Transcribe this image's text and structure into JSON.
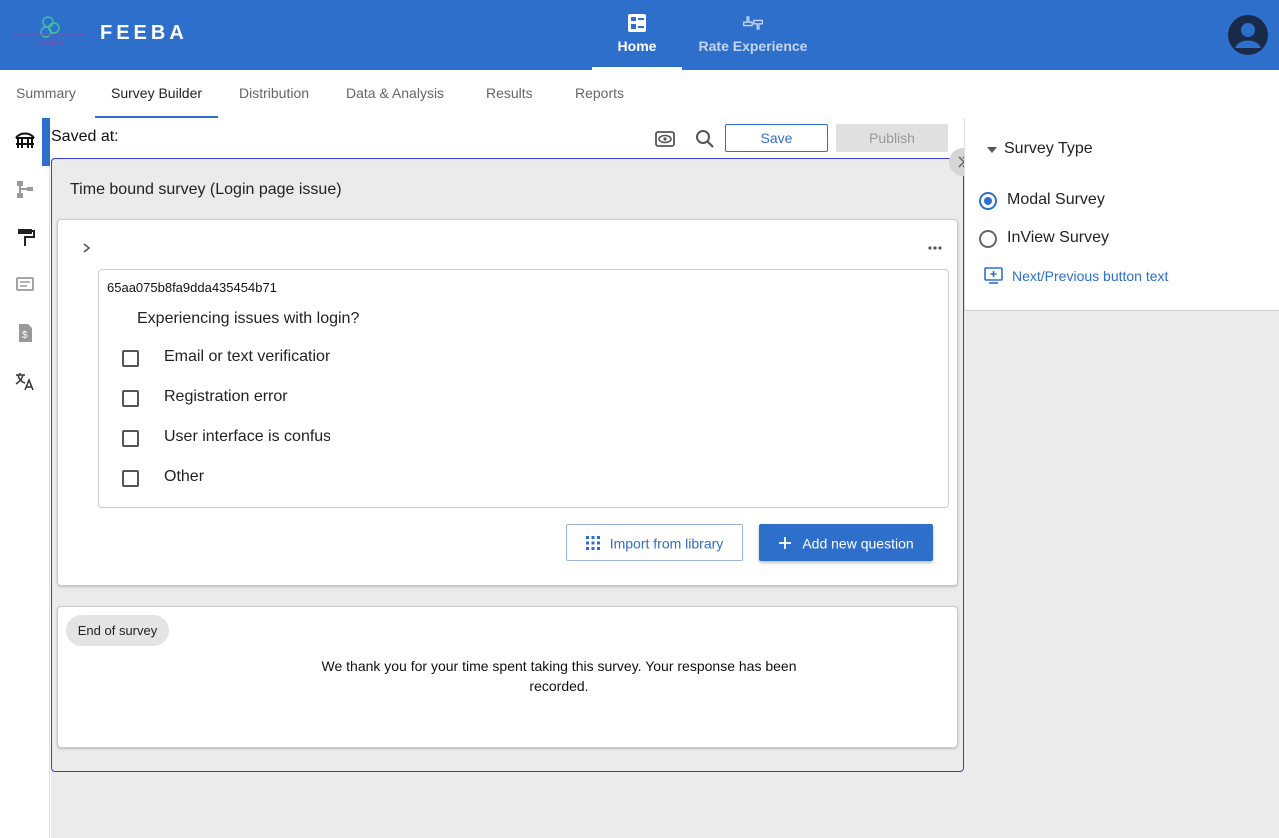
{
  "header": {
    "brand": "FEEBA",
    "logo_text": "Feeba",
    "nav": [
      {
        "label": "Home",
        "icon": "dashboard-icon"
      },
      {
        "label": "Rate Experience",
        "icon": "thumbs-up-down-icon"
      }
    ]
  },
  "tabs": [
    "Summary",
    "Survey Builder",
    "Distribution",
    "Data & Analysis",
    "Results",
    "Reports"
  ],
  "active_tab": "Survey Builder",
  "toolbar": {
    "saved_at": "Saved at:",
    "save_label": "Save",
    "publish_label": "Publish"
  },
  "survey": {
    "title": "Time bound survey (Login page issue)",
    "question": {
      "id": "65aa075b8fa9dda435454b71",
      "text": "Experiencing issues with login?",
      "options": [
        "Email or text verification",
        "Registration error",
        "User interface is confusing",
        "Other"
      ]
    },
    "import_label": "Import from library",
    "add_label": "Add new question",
    "end": {
      "chip": "End of survey",
      "message": "We thank you for your time spent taking this survey. Your response has been recorded."
    }
  },
  "right_panel": {
    "title": "Survey Type",
    "options": [
      {
        "label": "Modal Survey",
        "selected": true
      },
      {
        "label": "InView Survey",
        "selected": false
      }
    ],
    "next_prev_label": "Next/Previous button text"
  },
  "colors": {
    "primary": "#2f6fcc",
    "background": "#ebebeb",
    "frame_border": "#3b3bdb"
  }
}
